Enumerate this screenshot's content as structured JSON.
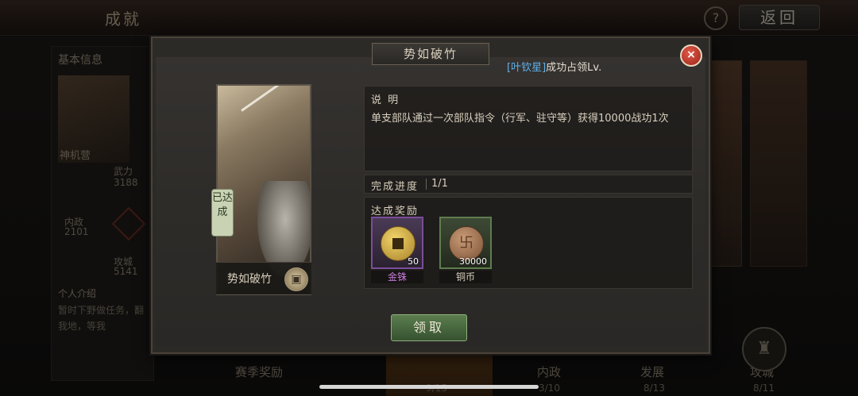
{
  "header": {
    "title": "成就",
    "help_label": "?",
    "back_label": "返回"
  },
  "left_panel": {
    "header": "基本信息",
    "portrait_name": "神机营",
    "stats": [
      {
        "label": "武力",
        "value": "3188"
      },
      {
        "label": "内政",
        "value": "2101"
      },
      {
        "label": "攻城",
        "value": "5141"
      }
    ],
    "intro_header": "个人介绍",
    "intro_text": "暂时下野做任务，翻我地，等我"
  },
  "bottom_nav": [
    {
      "label": "赛季奖励",
      "count": ""
    },
    {
      "label": "",
      "count": "9/15"
    },
    {
      "label": "内政",
      "count": "3/10"
    },
    {
      "label": "发展",
      "count": "8/13"
    },
    {
      "label": "攻城",
      "count": "8/11"
    }
  ],
  "modal": {
    "title": "势如破竹",
    "close_label": "×",
    "notice_player": "[叶钦星]",
    "notice_text": "成功占领Lv.",
    "card": {
      "badge": "已达成",
      "name": "势如破竹",
      "chest_label": "▣"
    },
    "description": {
      "title": "说 明",
      "text": "单支部队通过一次部队指令（行军、驻守等）获得10000战功1次"
    },
    "progress": {
      "label": "完成进度",
      "value": "1/1"
    },
    "rewards": {
      "title": "达成奖励",
      "items": [
        {
          "name": "金铢",
          "qty": "50",
          "rarity_color": "#c77ad8"
        },
        {
          "name": "铜币",
          "qty": "30000",
          "rarity_color": "#d8cfbd"
        }
      ]
    },
    "claim_label": "领取"
  }
}
